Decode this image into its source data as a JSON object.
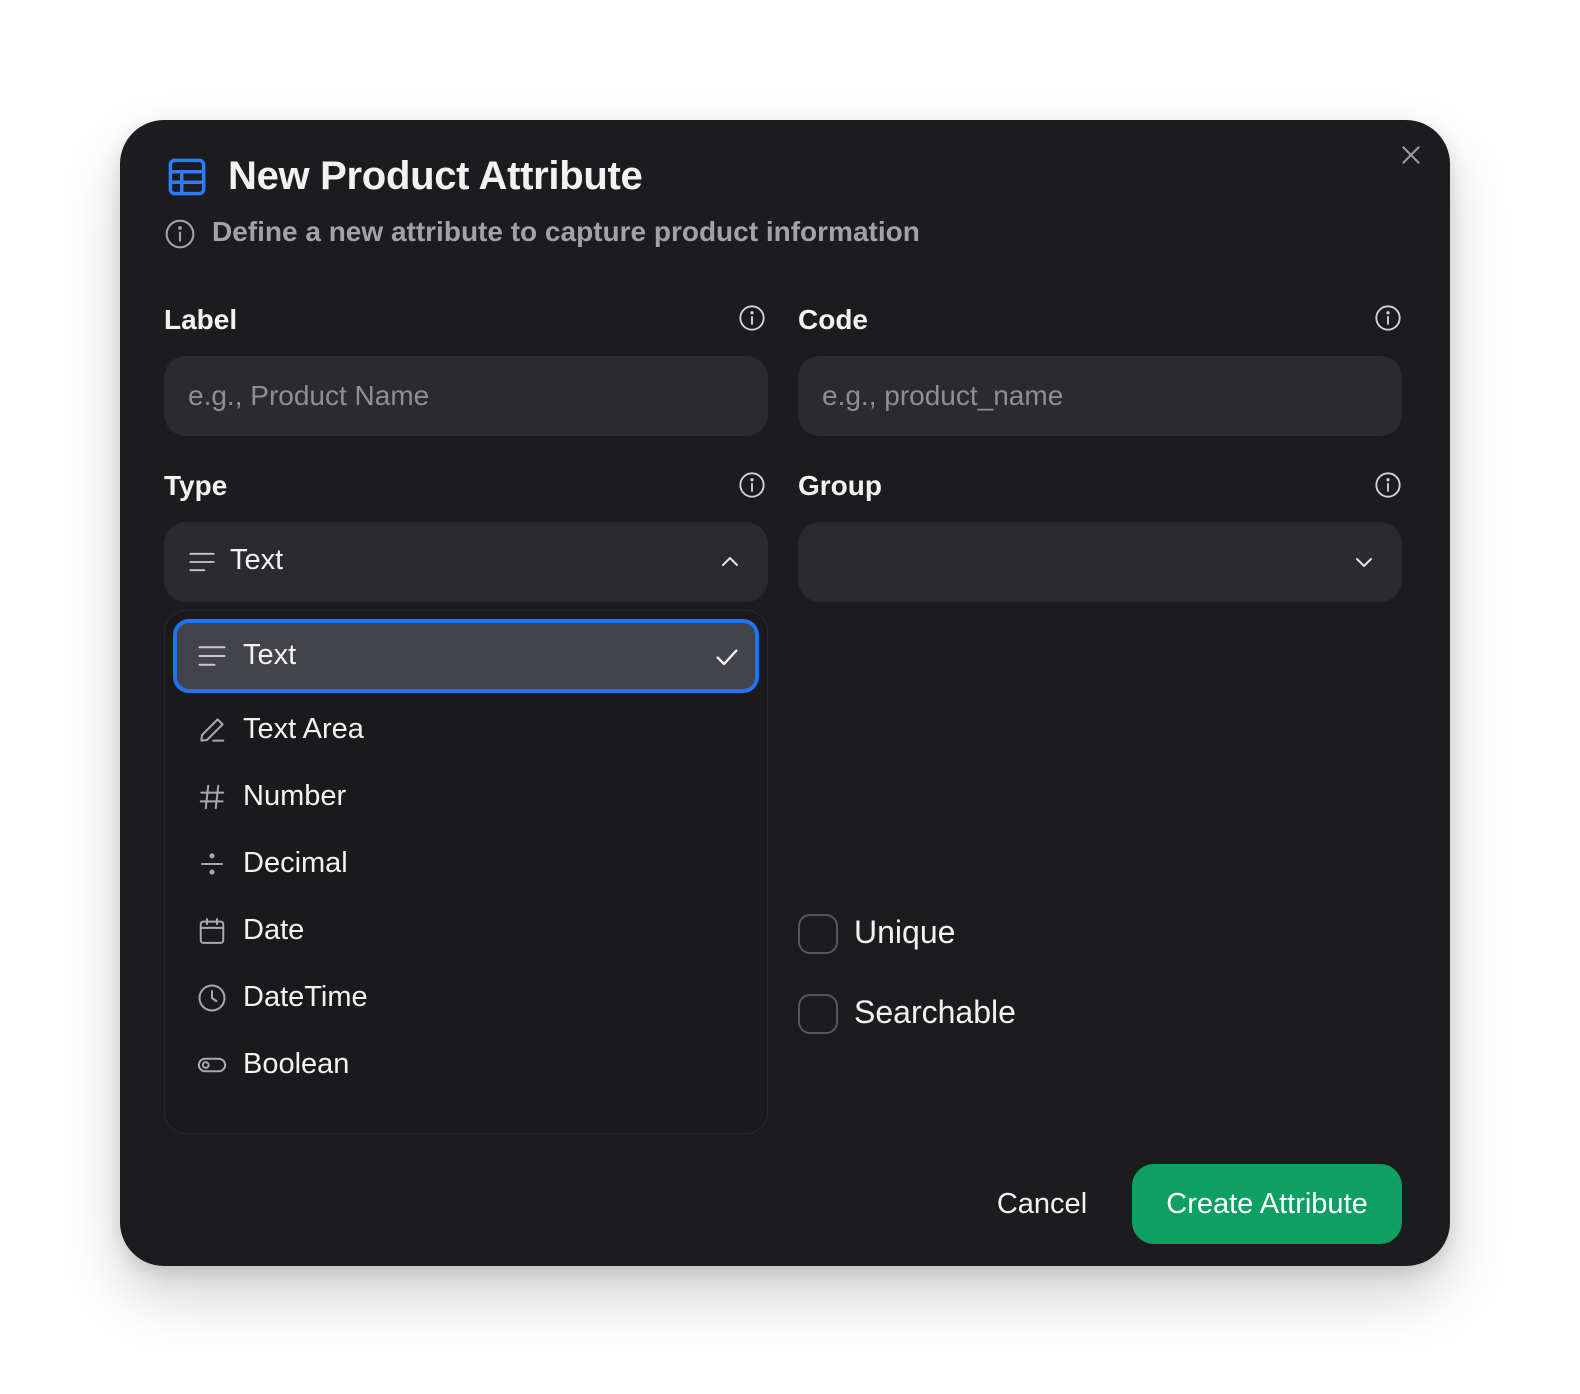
{
  "dialog": {
    "title": "New Product Attribute",
    "subtitle": "Define a new attribute to capture product information",
    "accent_color": "#1f74f0",
    "primary_color": "#0e9f63"
  },
  "fields": {
    "label": {
      "label": "Label",
      "placeholder": "e.g., Product Name",
      "value": ""
    },
    "code": {
      "label": "Code",
      "placeholder": "e.g., product_name",
      "value": ""
    },
    "type": {
      "label": "Type",
      "selected": "Text",
      "expanded": true
    },
    "group": {
      "label": "Group",
      "selected": ""
    }
  },
  "type_options": [
    {
      "label": "Text",
      "icon": "lines-icon",
      "selected": true
    },
    {
      "label": "Text Area",
      "icon": "pencil-icon",
      "selected": false
    },
    {
      "label": "Number",
      "icon": "hash-icon",
      "selected": false
    },
    {
      "label": "Decimal",
      "icon": "divide-icon",
      "selected": false
    },
    {
      "label": "Date",
      "icon": "calendar-icon",
      "selected": false
    },
    {
      "label": "DateTime",
      "icon": "clock-icon",
      "selected": false
    },
    {
      "label": "Boolean",
      "icon": "toggle-icon",
      "selected": false
    }
  ],
  "checkboxes": {
    "unique": {
      "label": "Unique",
      "checked": false
    },
    "searchable": {
      "label": "Searchable",
      "checked": false
    }
  },
  "actions": {
    "cancel": "Cancel",
    "create": "Create Attribute"
  }
}
